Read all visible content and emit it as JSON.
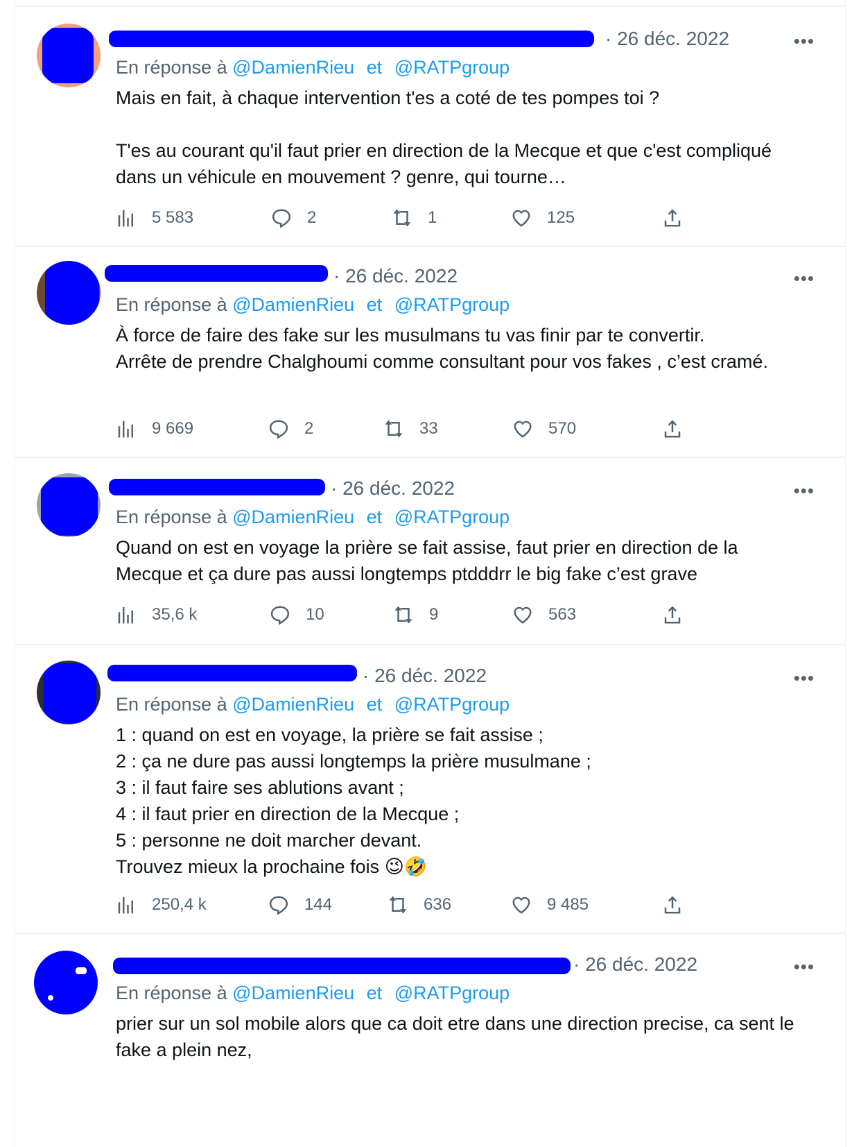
{
  "reply_prefix": "En réponse à",
  "mention_1": "@DamienRieu",
  "connector": "et",
  "mention_2": "@RATPgroup",
  "colors": {
    "link": "#1d9bf0",
    "muted": "#536471",
    "text": "#0f1419",
    "redaction": "#0000ff"
  },
  "icons": {
    "views": "bar-chart-icon",
    "replies": "comment-icon",
    "retweets": "retweet-icon",
    "likes": "heart-icon",
    "share": "share-icon",
    "more": "more-dots-icon"
  },
  "tweets": [
    {
      "date": "· 26 déc. 2022",
      "more": "•••",
      "text": "Mais en fait, à chaque intervention t'es a coté de tes pompes toi ?\n\nT'es au courant qu'il faut prier en direction de la Mecque et que c'est compliqué dans un véhicule en mouvement ? genre, qui tourne…",
      "views": "5 583",
      "replies": "2",
      "retweets": "1",
      "likes": "125"
    },
    {
      "date": "· 26 déc. 2022",
      "more": "•••",
      "text": "À force de faire des fake sur les musulmans tu vas finir par te convertir.\nArrête de prendre Chalghoumi comme consultant pour vos fakes , c’est cramé.",
      "views": "9 669",
      "replies": "2",
      "retweets": "33",
      "likes": "570"
    },
    {
      "date": "· 26 déc. 2022",
      "more": "•••",
      "text": "Quand on est en voyage la prière se fait assise, faut prier en direction de la Mecque et ça dure pas aussi longtemps ptdddrr le big fake c’est grave",
      "views": "35,6 k",
      "replies": "10",
      "retweets": "9",
      "likes": "563"
    },
    {
      "date": "· 26 déc. 2022",
      "more": "•••",
      "text": "1 : quand on est en voyage, la prière se fait assise ;\n2 : ça ne dure pas aussi longtemps la prière musulmane ;\n3 : il faut faire ses ablutions avant ;\n4 : il faut prier en direction de la Mecque ;\n5 : personne ne doit marcher devant.\nTrouvez mieux la prochaine fois",
      "emojis": "😉🤣",
      "views": "250,4 k",
      "replies": "144",
      "retweets": "636",
      "likes": "9 485"
    },
    {
      "date": "· 26 déc. 2022",
      "more": "•••",
      "text": "prier sur un sol mobile alors que ca doit etre dans une direction precise, ca sent le fake a plein nez,"
    }
  ]
}
